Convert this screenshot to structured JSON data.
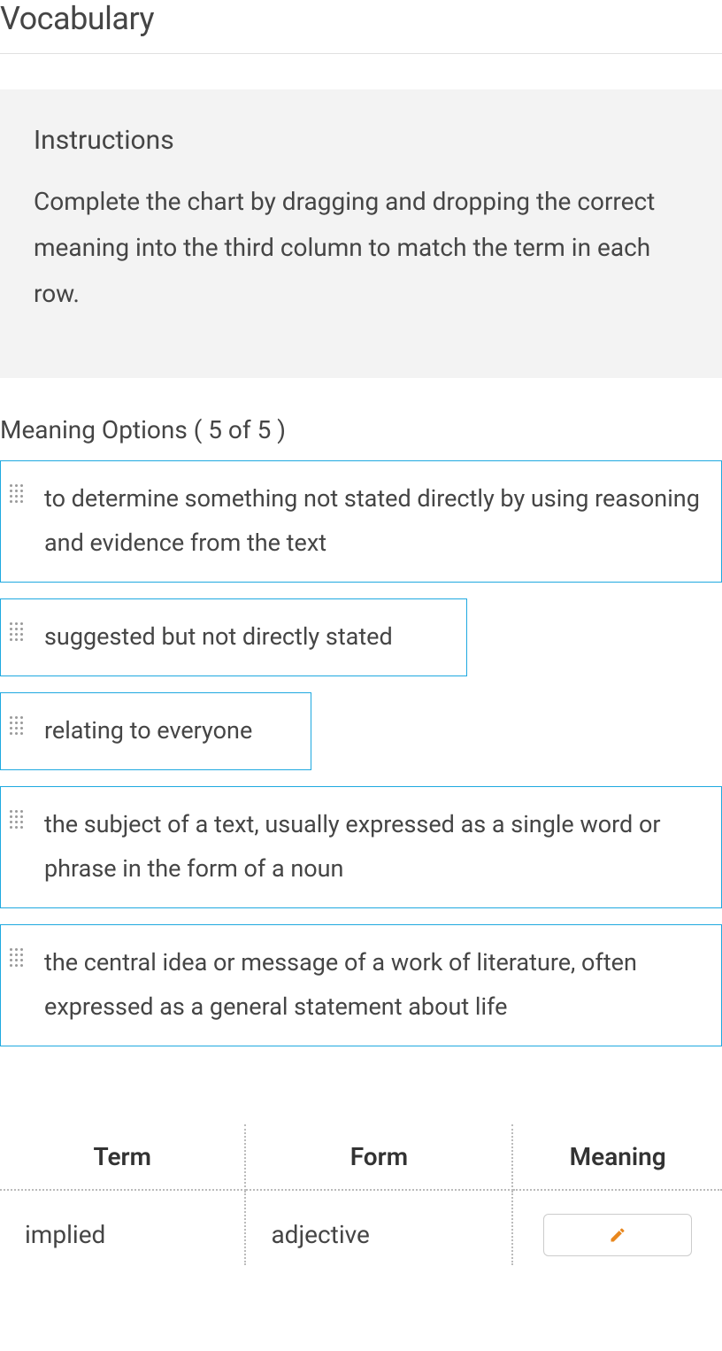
{
  "title": "Vocabulary",
  "instructions": {
    "heading": "Instructions",
    "text": "Complete the chart by dragging and dropping the correct meaning into the third column to match the term in each row."
  },
  "optionsLabel": "Meaning Options ( 5 of 5 )",
  "options": [
    "to determine something not stated directly by using reasoning and evidence from the text",
    "suggested but not directly stated",
    "relating to everyone",
    "the subject of a text, usually expressed as a single word or phrase in the form of a noun",
    "the central idea or message of a work of literature, often expressed as a general statement about life"
  ],
  "table": {
    "headers": [
      "Term",
      "Form",
      "Meaning"
    ],
    "rows": [
      {
        "term": "implied",
        "form": "adjective"
      }
    ]
  }
}
